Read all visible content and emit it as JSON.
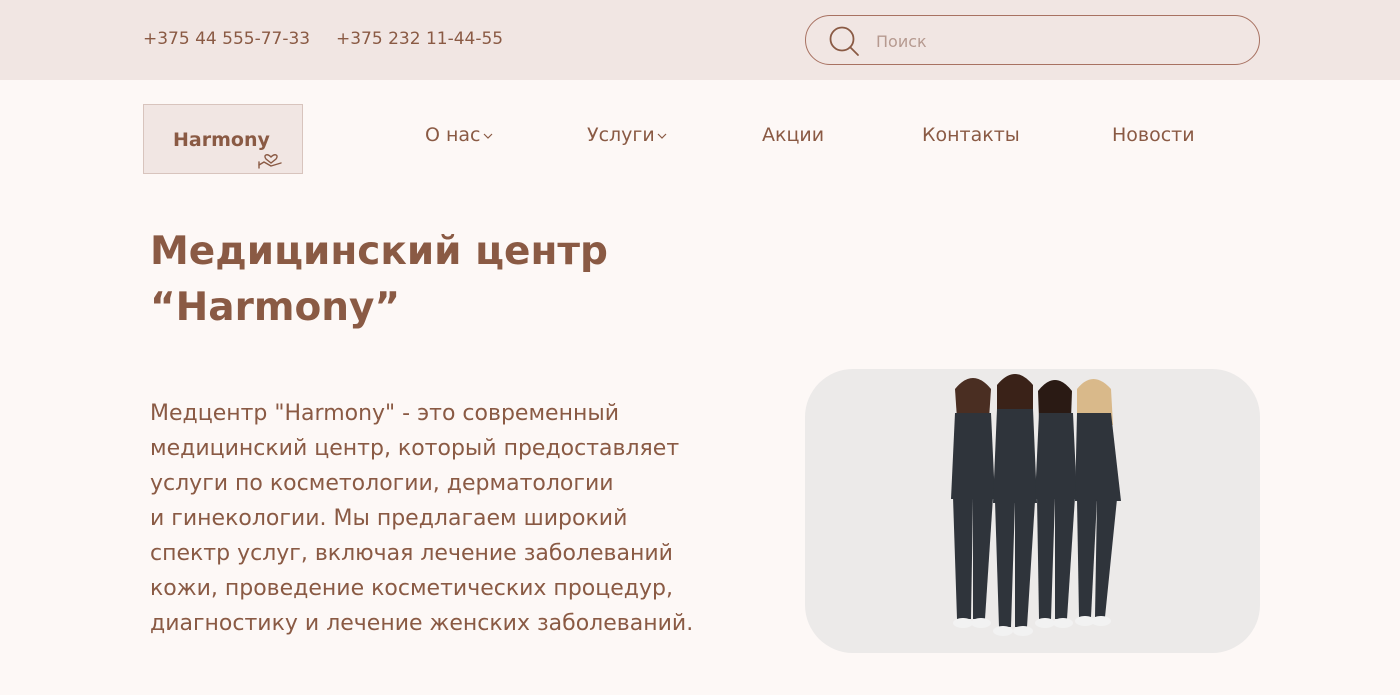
{
  "header": {
    "phones": [
      "+375 44 555-77-33",
      "+375 232 11-44-55"
    ],
    "search": {
      "placeholder": "Поиск",
      "icon": "search-icon"
    }
  },
  "logo": {
    "text": "Harmony",
    "icon": "hand-heart-icon"
  },
  "nav": {
    "items": [
      {
        "label": "О нас",
        "has_dropdown": true
      },
      {
        "label": "Услуги",
        "has_dropdown": true
      },
      {
        "label": "Акции",
        "has_dropdown": false
      },
      {
        "label": "Контакты",
        "has_dropdown": false
      },
      {
        "label": "Новости",
        "has_dropdown": false
      }
    ]
  },
  "hero": {
    "title_line1": "Медицинский центр",
    "title_line2": "“Harmony”",
    "description_lines": [
      "Медцентр \"Harmony\" - это современный",
      "медицинский центр, который предоставляет",
      "услуги по косметологии, дерматологии",
      "и гинекологии. Мы предлагаем широкий",
      "спектр услуг, включая лечение заболеваний",
      "кожи, проведение косметических процедур,",
      "диагностику и лечение женских заболеваний."
    ],
    "image": "medical-staff-group-photo"
  },
  "colors": {
    "brand_brown": "#8a5a44",
    "topbar_bg": "#f1e6e3",
    "page_bg": "#fdf8f6",
    "photo_bg": "#eceae9",
    "scrubs": "#2f343b"
  }
}
